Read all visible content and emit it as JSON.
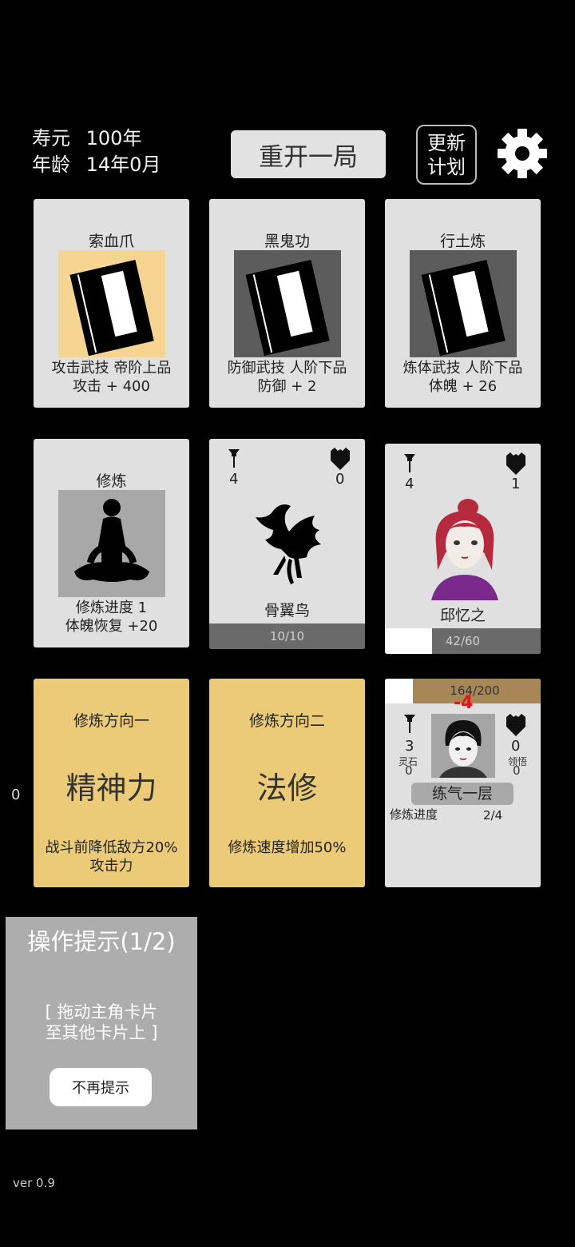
{
  "header": {
    "lifespan_label": "寿元",
    "lifespan_value": "100年",
    "age_label": "年龄",
    "age_value": "14年0月",
    "restart_label": "重开一局",
    "update_line1": "更新",
    "update_line2": "计划",
    "settings_icon": "gear-icon"
  },
  "skill_cards": [
    {
      "title": "索血爪",
      "desc1": "攻击武技   帝阶上品",
      "desc2": "攻击 + 400",
      "highlight": "#f6d491"
    },
    {
      "title": "黑鬼功",
      "desc1": "防御武技   人阶下品",
      "desc2": "防御 + 2"
    },
    {
      "title": "行土炼",
      "desc1": "炼体武技   人阶下品",
      "desc2": "体魄 + 26"
    }
  ],
  "cultivate_card": {
    "title": "修炼",
    "desc1": "修炼进度   1",
    "desc2": "体魄恢复   +20"
  },
  "bird_card": {
    "attack": "4",
    "defense": "0",
    "name": "骨翼鸟",
    "hp": "10/10"
  },
  "girl_card": {
    "attack": "4",
    "defense": "1",
    "name": "邱忆之",
    "hp": "42/60",
    "hp_fraction": 0.7
  },
  "direction_cards": [
    {
      "title": "修炼方向一",
      "big": "精神力",
      "desc1": "战斗前降低敌方20%",
      "desc2": "攻击力"
    },
    {
      "title": "修炼方向二",
      "big": "法修",
      "desc1": "修炼速度增加50%",
      "desc2": ""
    }
  ],
  "player_card": {
    "hp": "164/200",
    "hp_fraction": 0.82,
    "damage": "-4",
    "attack": "3",
    "defense": "0",
    "stone_label": "灵石",
    "stone_value": "0",
    "insight_label": "领悟",
    "insight_value": "0",
    "realm": "练气一层",
    "progress_label": "修炼进度",
    "progress_value": "2/4"
  },
  "left_counter": "0",
  "hint": {
    "title": "操作提示(1/2)",
    "line1": "[ 拖动主角卡片",
    "line2": "至其他卡片上 ]",
    "button": "不再提示"
  },
  "version": "ver 0.9"
}
